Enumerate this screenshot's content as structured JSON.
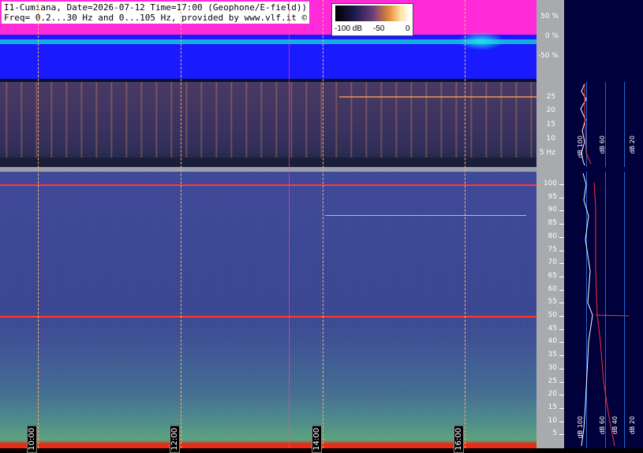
{
  "header": {
    "line1": "I1-Cumiana, Date=2026-07-12 Time=17:00 (Geophone/E-field))",
    "line2": "Freq= 0.2...30 Hz and 0...105 Hz, provided by www.vlf.it ©"
  },
  "colorbar": {
    "label_min": "-100 dB",
    "label_mid": "-50",
    "label_max": "0"
  },
  "amplitude_scale": [
    "50 %",
    "0 %",
    "-50 %"
  ],
  "low_freq_scale": [
    "25",
    "20",
    "15",
    "10",
    "5 Hz"
  ],
  "high_freq_scale": [
    "100",
    "95",
    "90",
    "85",
    "80",
    "75",
    "70",
    "65",
    "60",
    "55",
    "50",
    "45",
    "40",
    "35",
    "30",
    "25",
    "20",
    "15",
    "10",
    "5"
  ],
  "time_labels": [
    "10:00",
    "12:00",
    "14:00",
    "16:00"
  ],
  "power_panel_top": {
    "labels": [
      "dB 100",
      "dB 60",
      "dB 20"
    ]
  },
  "power_panel_bottom": {
    "labels": [
      "dB 100",
      "dB 60",
      "dB 40",
      "dB 20"
    ]
  },
  "colors": {
    "amplitude_bg": "#1a1aff",
    "amplitude_env": "#ff2bd9",
    "spectrogram_low": "#3b3260",
    "spectrogram_high": "#3a4496",
    "scale_bg": "#a8aaae",
    "power_bg": "#00003a",
    "marker_red": "#ff3a2a"
  }
}
